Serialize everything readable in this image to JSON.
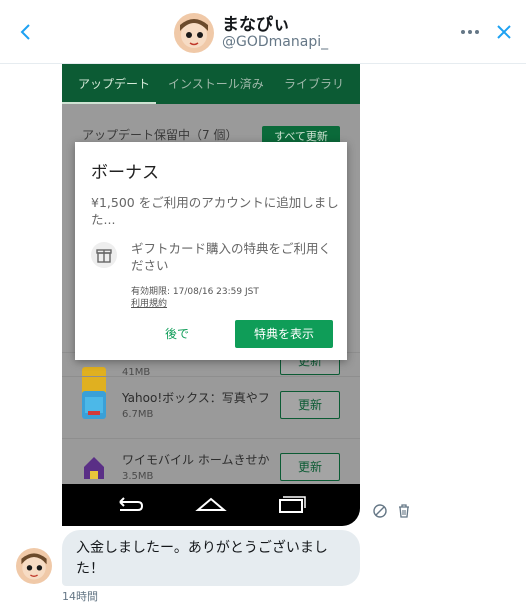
{
  "header": {
    "name": "まなぴぃ",
    "handle": "@GODmanapi_"
  },
  "screenshot": {
    "tabs": [
      {
        "label": "アップデート"
      },
      {
        "label": "インストール済み"
      },
      {
        "label": "ライブラリ"
      }
    ],
    "pending_label": "アップデート保留中（7 個）",
    "update_all_label": "すべて更新",
    "apps": [
      {
        "title": "",
        "size": "41MB",
        "update_label": "更新"
      },
      {
        "title": "Yahoo!ボックス：写真やフ",
        "size": "6.7MB",
        "update_label": "更新"
      },
      {
        "title": "ワイモバイル ホームきせか",
        "size": "3.5MB",
        "update_label": "更新"
      }
    ]
  },
  "dialog": {
    "title": "ボーナス",
    "body": "¥1,500 をご利用のアカウントに追加しました...",
    "gift_text": "ギフトカード購入の特典をご利用ください",
    "expiry": "有効期限: 17/08/16 23:59 JST",
    "terms": "利用規約",
    "later_label": "後で",
    "show_label": "特典を表示"
  },
  "message": {
    "text": "入金しましたー。ありがとうございました！",
    "time": "14時間"
  },
  "colors": {
    "play_green": "#0f9d58",
    "appbar_green": "#0c5b34",
    "bubble_gray": "#e6ecf0",
    "twitter_blue": "#1da1f2"
  }
}
